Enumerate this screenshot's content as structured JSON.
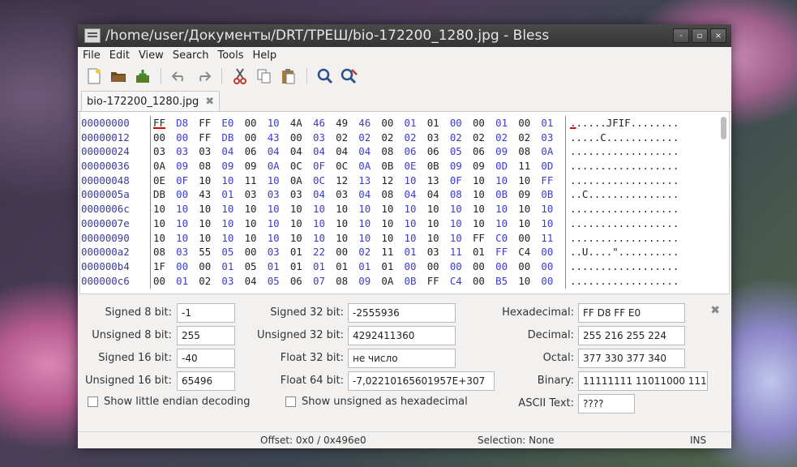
{
  "window": {
    "title": "/home/user/Документы/DRT/ТРЕШ/bio-172200_1280.jpg - Bless",
    "minimize": "-",
    "maximize": "▫",
    "close": "×"
  },
  "menu": [
    "File",
    "Edit",
    "View",
    "Search",
    "Tools",
    "Help"
  ],
  "tab": {
    "label": "bio-172200_1280.jpg",
    "close": "✖"
  },
  "hex": {
    "offsets": [
      "00000000",
      "00000012",
      "00000024",
      "00000036",
      "00000048",
      "0000005a",
      "0000006c",
      "0000007e",
      "00000090",
      "000000a2",
      "000000b4",
      "000000c6"
    ],
    "rows": [
      [
        "FF",
        "D8",
        "FF",
        "E0",
        "00",
        "10",
        "4A",
        "46",
        "49",
        "46",
        "00",
        "01",
        "01",
        "00",
        "00",
        "01",
        "00",
        "01"
      ],
      [
        "00",
        "00",
        "FF",
        "DB",
        "00",
        "43",
        "00",
        "03",
        "02",
        "02",
        "02",
        "02",
        "03",
        "02",
        "02",
        "02",
        "02",
        "03"
      ],
      [
        "03",
        "03",
        "03",
        "04",
        "06",
        "04",
        "04",
        "04",
        "04",
        "04",
        "08",
        "06",
        "06",
        "05",
        "06",
        "09",
        "08",
        "0A"
      ],
      [
        "0A",
        "09",
        "08",
        "09",
        "09",
        "0A",
        "0C",
        "0F",
        "0C",
        "0A",
        "0B",
        "0E",
        "0B",
        "09",
        "09",
        "0D",
        "11",
        "0D"
      ],
      [
        "0E",
        "0F",
        "10",
        "10",
        "11",
        "10",
        "0A",
        "0C",
        "12",
        "13",
        "12",
        "10",
        "13",
        "0F",
        "10",
        "10",
        "10",
        "FF"
      ],
      [
        "DB",
        "00",
        "43",
        "01",
        "03",
        "03",
        "03",
        "04",
        "03",
        "04",
        "08",
        "04",
        "04",
        "08",
        "10",
        "0B",
        "09",
        "0B"
      ],
      [
        "10",
        "10",
        "10",
        "10",
        "10",
        "10",
        "10",
        "10",
        "10",
        "10",
        "10",
        "10",
        "10",
        "10",
        "10",
        "10",
        "10",
        "10"
      ],
      [
        "10",
        "10",
        "10",
        "10",
        "10",
        "10",
        "10",
        "10",
        "10",
        "10",
        "10",
        "10",
        "10",
        "10",
        "10",
        "10",
        "10",
        "10"
      ],
      [
        "10",
        "10",
        "10",
        "10",
        "10",
        "10",
        "10",
        "10",
        "10",
        "10",
        "10",
        "10",
        "10",
        "10",
        "FF",
        "C0",
        "00",
        "11"
      ],
      [
        "08",
        "03",
        "55",
        "05",
        "00",
        "03",
        "01",
        "22",
        "00",
        "02",
        "11",
        "01",
        "03",
        "11",
        "01",
        "FF",
        "C4",
        "00"
      ],
      [
        "1F",
        "00",
        "00",
        "01",
        "05",
        "01",
        "01",
        "01",
        "01",
        "01",
        "01",
        "00",
        "00",
        "00",
        "00",
        "00",
        "00",
        "00"
      ],
      [
        "00",
        "01",
        "02",
        "03",
        "04",
        "05",
        "06",
        "07",
        "08",
        "09",
        "0A",
        "0B",
        "FF",
        "C4",
        "00",
        "B5",
        "10",
        "00"
      ]
    ],
    "ascii": [
      "......JFIF........",
      ".....C............",
      "..................",
      "..................",
      "..................",
      "..C...............",
      "..................",
      "..................",
      "..................",
      "..U....\"..........",
      "..................",
      ".................."
    ]
  },
  "panel": {
    "s8_label": "Signed 8 bit:",
    "s8": "-1",
    "u8_label": "Unsigned 8 bit:",
    "u8": "255",
    "s16_label": "Signed 16 bit:",
    "s16": "-40",
    "u16_label": "Unsigned 16 bit:",
    "u16": "65496",
    "s32_label": "Signed 32 bit:",
    "s32": "-2555936",
    "u32_label": "Unsigned 32 bit:",
    "u32": "4292411360",
    "f32_label": "Float 32 bit:",
    "f32": "не число",
    "f64_label": "Float 64 bit:",
    "f64": "-7,02210165601957E+307",
    "hex_label": "Hexadecimal:",
    "hex": "FF D8 FF E0",
    "dec_label": "Decimal:",
    "dec": "255 216 255 224",
    "oct_label": "Octal:",
    "oct": "377 330 377 340",
    "bin_label": "Binary:",
    "bin": "11111111 11011000 111",
    "ascii_label": "ASCII Text:",
    "ascii": "????",
    "little_endian": "Show little endian decoding",
    "unsigned_hex": "Show unsigned as hexadecimal",
    "close": "✖"
  },
  "status": {
    "offset": "Offset: 0x0 / 0x496e0",
    "selection": "Selection: None",
    "mode": "INS"
  }
}
